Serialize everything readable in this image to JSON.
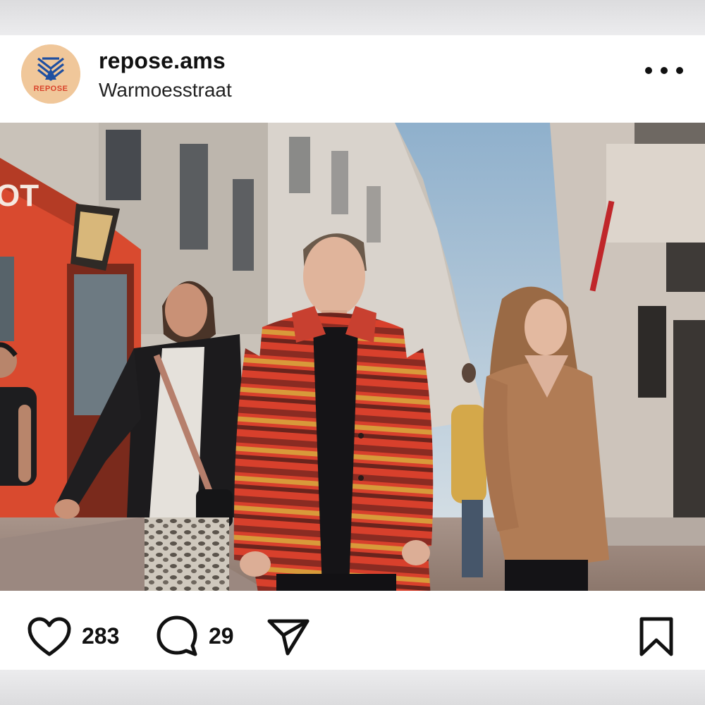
{
  "post": {
    "username": "repose.ams",
    "location": "Warmoesstraat",
    "avatar": {
      "logo_text": "REPOSE",
      "background": "#f0c79a",
      "mark_color": "#1f4fa0",
      "text_color": "#d9432b"
    },
    "photo": {
      "description_icon": "street-photo",
      "sign_fragment": "OT"
    },
    "likes": "283",
    "comments": "29"
  },
  "icons": {
    "more": "more-dots-icon",
    "like": "heart-icon",
    "comment": "comment-bubble-icon",
    "share": "paper-plane-icon",
    "save": "bookmark-icon"
  }
}
